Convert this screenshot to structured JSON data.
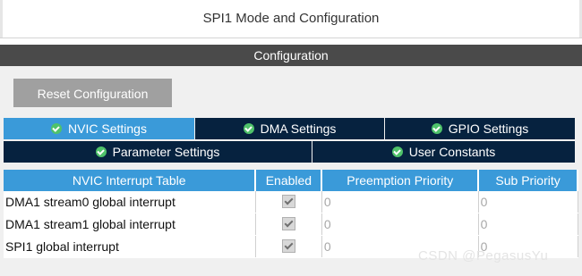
{
  "window": {
    "title": "SPI1 Mode and Configuration"
  },
  "config": {
    "header": "Configuration",
    "reset_label": "Reset Configuration"
  },
  "tabs": [
    {
      "label": "NVIC Settings",
      "active": true
    },
    {
      "label": "DMA Settings",
      "active": false
    },
    {
      "label": "GPIO Settings",
      "active": false
    },
    {
      "label": "Parameter Settings",
      "active": false
    },
    {
      "label": "User Constants",
      "active": false
    }
  ],
  "table": {
    "columns": [
      "NVIC Interrupt Table",
      "Enabled",
      "Preemption Priority",
      "Sub Priority"
    ],
    "rows": [
      {
        "name": "DMA1 stream0 global interrupt",
        "enabled": true,
        "preemption": "0",
        "sub": "0"
      },
      {
        "name": "DMA1 stream1 global interrupt",
        "enabled": true,
        "preemption": "0",
        "sub": "0"
      },
      {
        "name": "SPI1 global interrupt",
        "enabled": true,
        "preemption": "0",
        "sub": "0"
      }
    ]
  },
  "watermark": "CSDN @PegasusYu",
  "colors": {
    "tab_active": "#3a9ad9",
    "tab_inactive": "#06223f",
    "header": "#4a4a4a",
    "check": "#4fc26a"
  }
}
